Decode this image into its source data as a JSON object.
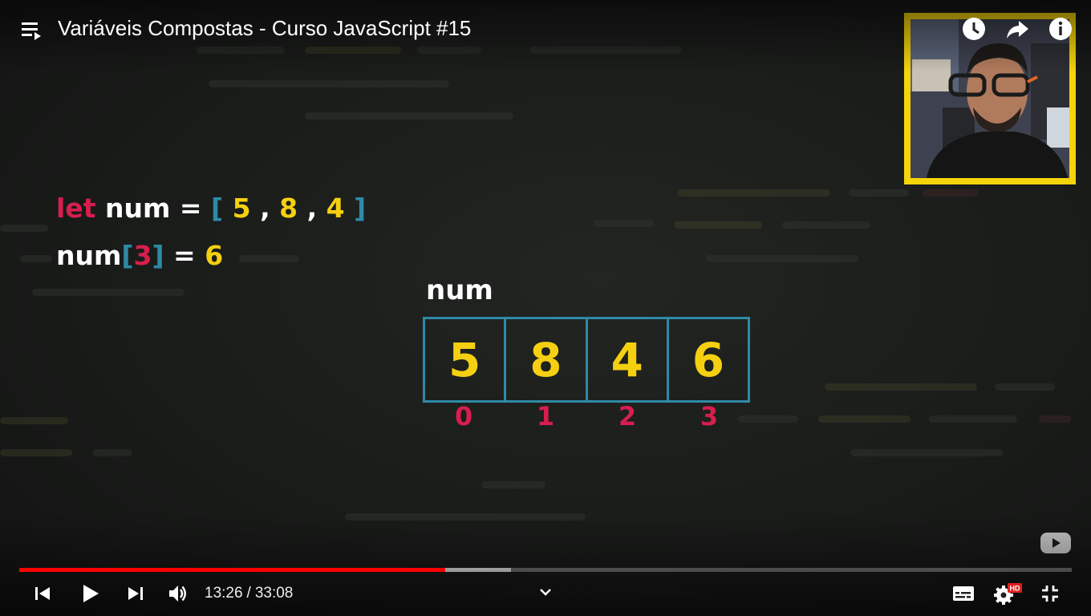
{
  "header": {
    "title": "Variáveis Compostas - Curso JavaScript #15"
  },
  "code": {
    "line1": {
      "keyword": "let",
      "var": "num",
      "eq": "=",
      "open": "[",
      "values": [
        "5",
        "8",
        "4"
      ],
      "sep": ",",
      "close": "]"
    },
    "line2": {
      "var": "num",
      "open": "[",
      "index": "3",
      "close": "]",
      "eq": "=",
      "value": "6"
    }
  },
  "array_diagram": {
    "label": "num",
    "cells": [
      "5",
      "8",
      "4",
      "6"
    ],
    "indices": [
      "0",
      "1",
      "2",
      "3"
    ]
  },
  "player": {
    "current_time": "13:26",
    "duration": "33:08",
    "separator": "/",
    "played_fraction": 0.405,
    "buffered_fraction": 0.467,
    "hd_badge": "HD"
  },
  "icons": {
    "playlist": "playlist-icon",
    "watch_later": "clock-icon",
    "share": "share-icon",
    "info": "info-icon",
    "youtube": "youtube-logo-icon",
    "previous": "previous-icon",
    "play": "play-icon",
    "next": "next-icon",
    "volume": "volume-icon",
    "chevron": "chevron-down-icon",
    "subtitles": "subtitles-icon",
    "settings": "gear-icon",
    "fullscreen_exit": "exit-fullscreen-icon"
  },
  "colors": {
    "keyword": "#d81e4e",
    "bracket": "#2e8aa6",
    "number": "#f5d010",
    "index": "#d81e4e",
    "progress_played": "#ff0000",
    "webcam_frame": "#f5d40a"
  }
}
